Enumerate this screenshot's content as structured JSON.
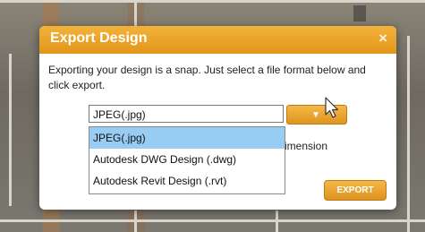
{
  "dialog": {
    "title": "Export Design",
    "close_glyph": "×",
    "message": "Exporting your design is a snap. Just select a file format below and click export.",
    "format_select": {
      "selected": "JPEG(.jpg)",
      "options": [
        "JPEG(.jpg)",
        "Autodesk DWG Design (.dwg)",
        "Autodesk Revit Design (.rvt)"
      ]
    },
    "partial_label": "imension",
    "export_label": "EXPORT",
    "caret_glyph": "▼"
  },
  "colors": {
    "accent": "#e8a22a",
    "highlight": "#99ccf2"
  },
  "icons": {
    "close": "close-icon",
    "dropdown": "chevron-down-icon",
    "cursor": "mouse-pointer-icon"
  }
}
